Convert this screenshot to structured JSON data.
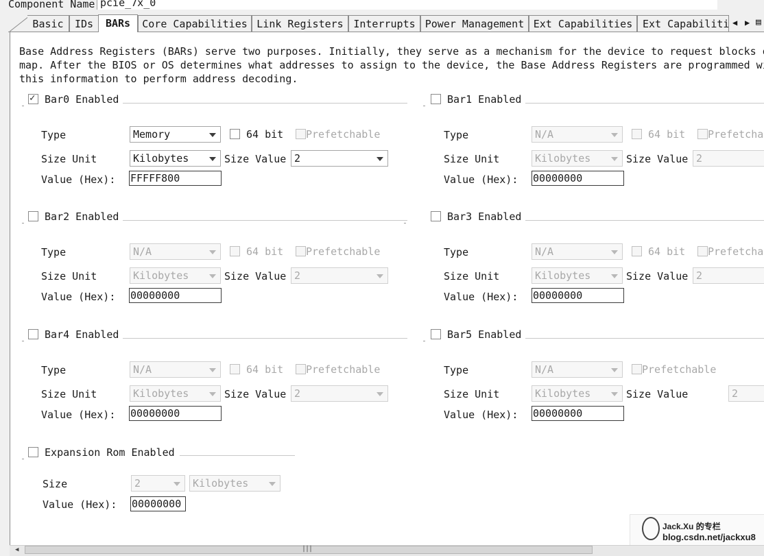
{
  "component": {
    "label": "Component Name",
    "value": "pcie_7x_0"
  },
  "tabs": [
    "Basic",
    "IDs",
    "BARs",
    "Core Capabilities",
    "Link Registers",
    "Interrupts",
    "Power Management",
    "Ext Capabilities",
    "Ext Capabiliti"
  ],
  "active_tab": "BARs",
  "description": [
    "Base Address Registers (BARs) serve two purposes. Initially, they serve as a mechanism for the device to request blocks of",
    "map. After the BIOS or OS determines what addresses to assign to the device, the Base Address Registers are programmed with",
    "this information to perform address decoding."
  ],
  "labels": {
    "type": "Type",
    "size_unit": "Size Unit",
    "size_value": "Size Value",
    "value_hex": "Value (Hex):",
    "bit64": "64 bit",
    "prefetchable": "Prefetchable",
    "prefetchable_cut": "Prefetcha",
    "size": "Size"
  },
  "bars": [
    {
      "title": "Bar0 Enabled",
      "enabled": true,
      "type": "Memory",
      "size_unit": "Kilobytes",
      "size_value": "2",
      "hex": "FFFFF800"
    },
    {
      "title": "Bar1 Enabled",
      "enabled": false,
      "type": "N/A",
      "size_unit": "Kilobytes",
      "size_value": "2",
      "hex": "00000000"
    },
    {
      "title": "Bar2 Enabled",
      "enabled": false,
      "type": "N/A",
      "size_unit": "Kilobytes",
      "size_value": "2",
      "hex": "00000000"
    },
    {
      "title": "Bar3 Enabled",
      "enabled": false,
      "type": "N/A",
      "size_unit": "Kilobytes",
      "size_value": "2",
      "hex": "00000000"
    },
    {
      "title": "Bar4 Enabled",
      "enabled": false,
      "type": "N/A",
      "size_unit": "Kilobytes",
      "size_value": "2",
      "hex": "00000000"
    },
    {
      "title": "Bar5 Enabled",
      "enabled": false,
      "type": "N/A",
      "size_unit": "Kilobytes",
      "size_value": "2",
      "hex": "00000000"
    }
  ],
  "expansion_rom": {
    "title": "Expansion Rom Enabled",
    "enabled": false,
    "size": "2",
    "unit": "Kilobytes",
    "hex": "00000000"
  },
  "watermark": {
    "name": "Jack.Xu 的专栏",
    "url": "blog.csdn.net/jackxu8"
  },
  "icons": {
    "checkmark": "check-icon",
    "dropdown": "chevron-down-icon",
    "tab_left": "triangle-left-icon",
    "tab_right": "triangle-right-icon",
    "tab_list": "list-icon"
  }
}
